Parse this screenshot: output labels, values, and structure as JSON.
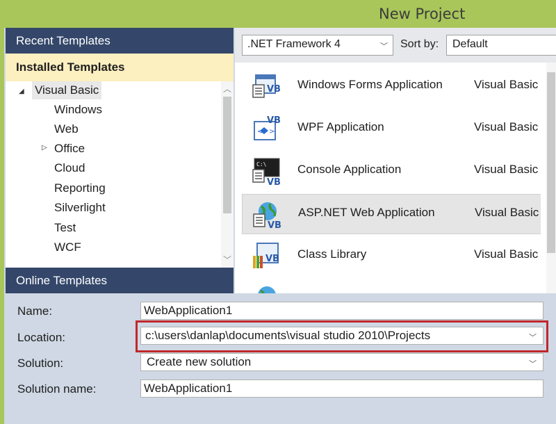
{
  "window": {
    "title": "New Project"
  },
  "left_panel": {
    "recent_label": "Recent Templates",
    "installed_label": "Installed Templates",
    "online_label": "Online Templates",
    "tree": [
      {
        "label": "Visual Basic",
        "expanded": true,
        "selected": true
      },
      {
        "label": "Windows"
      },
      {
        "label": "Web"
      },
      {
        "label": "Office",
        "has_children": true
      },
      {
        "label": "Cloud"
      },
      {
        "label": "Reporting"
      },
      {
        "label": "Silverlight"
      },
      {
        "label": "Test"
      },
      {
        "label": "WCF"
      }
    ]
  },
  "toolbar": {
    "framework": ".NET Framework 4",
    "sort_label": "Sort by:",
    "sort_value": "Default"
  },
  "templates": [
    {
      "name": "Windows Forms Application",
      "language": "Visual Basic",
      "icon": "windows-forms-icon"
    },
    {
      "name": "WPF Application",
      "language": "Visual Basic",
      "icon": "wpf-icon"
    },
    {
      "name": "Console Application",
      "language": "Visual Basic",
      "icon": "console-icon"
    },
    {
      "name": "ASP.NET Web Application",
      "language": "Visual Basic",
      "icon": "web-app-icon",
      "selected": true
    },
    {
      "name": "Class Library",
      "language": "Visual Basic",
      "icon": "class-library-icon"
    }
  ],
  "form": {
    "name_label": "Name:",
    "name_value": "WebApplication1",
    "location_label": "Location:",
    "location_value": "c:\\users\\danlap\\documents\\visual studio 2010\\Projects",
    "solution_label": "Solution:",
    "solution_value": "Create new solution",
    "solution_name_label": "Solution name:",
    "solution_name_value": "WebApplication1"
  },
  "colors": {
    "title_bar": "#a8c65a",
    "panel_header": "#34476a",
    "installed_header": "#fcefc0",
    "highlight": "#c0282c"
  }
}
